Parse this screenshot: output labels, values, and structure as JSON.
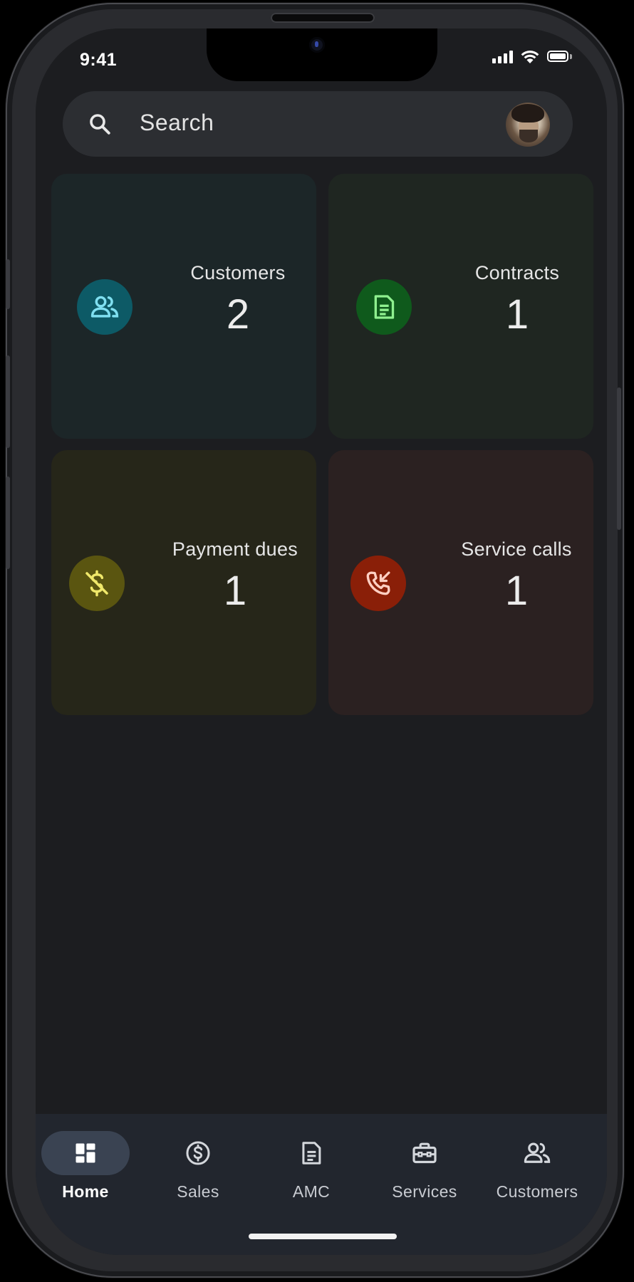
{
  "status_bar": {
    "time": "9:41"
  },
  "search": {
    "placeholder": "Search",
    "icon": "search-icon",
    "avatar": "profile-avatar"
  },
  "cards": [
    {
      "label": "Customers",
      "count": "2",
      "icon": "people-icon",
      "color": "#0d5a66",
      "icon_color": "#7fdff0"
    },
    {
      "label": "Contracts",
      "count": "1",
      "icon": "document-icon",
      "color": "#0f5a1c",
      "icon_color": "#8ff08f"
    },
    {
      "label": "Payment dues",
      "count": "1",
      "icon": "money-off-icon",
      "color": "#5a5510",
      "icon_color": "#f0e86a"
    },
    {
      "label": "Service calls",
      "count": "1",
      "icon": "phone-callback-icon",
      "color": "#8a1f08",
      "icon_color": "#ffcfc2"
    }
  ],
  "bottom_nav": [
    {
      "label": "Home",
      "icon": "dashboard-icon",
      "active": true
    },
    {
      "label": "Sales",
      "icon": "dollar-circle-icon",
      "active": false
    },
    {
      "label": "AMC",
      "icon": "document-icon",
      "active": false
    },
    {
      "label": "Services",
      "icon": "toolbox-icon",
      "active": false
    },
    {
      "label": "Customers",
      "icon": "people-icon",
      "active": false
    }
  ],
  "colors": {
    "background": "#1c1d20",
    "nav_background": "#22262e",
    "active_pill": "#3a4352"
  }
}
